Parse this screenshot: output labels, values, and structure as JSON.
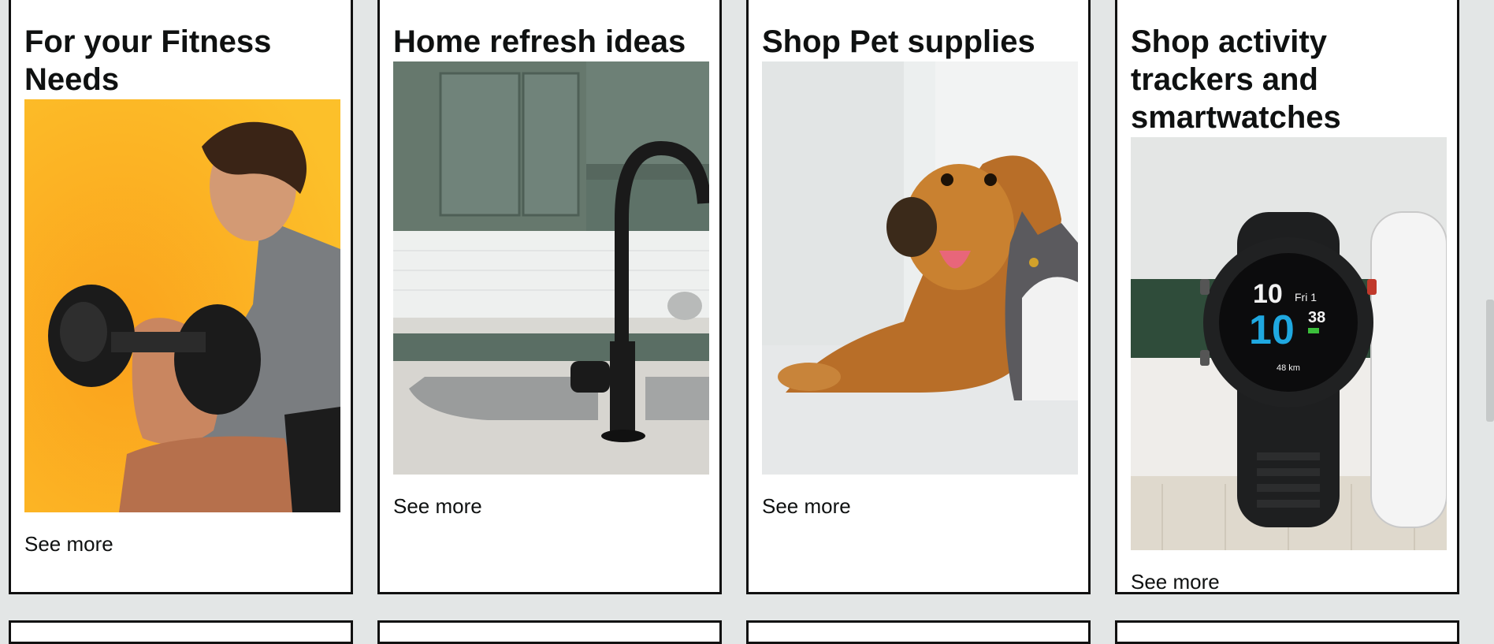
{
  "cards": [
    {
      "title": "For your Fitness Needs",
      "link": "See more",
      "image": "man-lifting-dumbbell-photo"
    },
    {
      "title": "Home refresh ideas",
      "link": "See more",
      "image": "kitchen-faucet-sink-photo"
    },
    {
      "title": "Shop Pet supplies",
      "link": "See more",
      "image": "dog-and-cat-photo"
    },
    {
      "title": "Shop activity trackers and smartwatches",
      "link": "See more",
      "image": "smartwatches-photo"
    }
  ],
  "watch_face": {
    "hour_small": "10",
    "day": "Fri 1",
    "time_big": "10",
    "minutes": "38",
    "distance": "48 km"
  },
  "colors": {
    "page_background": "#e3e6e6",
    "card_background": "#ffffff",
    "card_border": "#111111",
    "fitness_bg": "#f9b21e",
    "watch_accent": "#1fa8e0"
  }
}
